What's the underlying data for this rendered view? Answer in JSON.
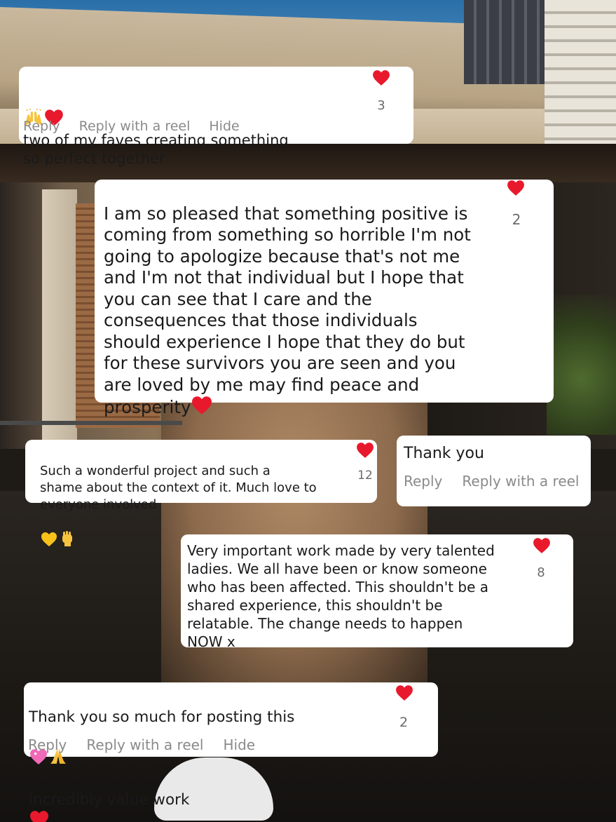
{
  "colors": {
    "heart": "#e8192c",
    "action_text": "#8a8a8a",
    "count_text": "#6b6b6b",
    "bubble": "#ffffff"
  },
  "comments": [
    {
      "text": "two of my faves creating something\nso perfect together",
      "leading_emojis": [
        "raising-hands-emoji",
        "red-heart-emoji"
      ],
      "like_count": "3",
      "actions": [
        "Reply",
        "Reply with a reel",
        "Hide"
      ]
    },
    {
      "text": "I am so pleased that something positive is\ncoming from something so horrible I'm not\ngoing to apologize because that's not me\nand I'm not that individual but I hope that\nyou can see that I care and the\nconsequences that those individuals\nshould experience I hope that they do but\nfor these survivors you are seen and you\nare loved by me may find peace and\nprosperity",
      "trailing_emojis": [
        "red-heart-emoji"
      ],
      "like_count": "2"
    },
    {
      "text": "Such a wonderful project and such a\nshame about the context of it. Much love to\neveryone involved",
      "trailing_emojis": [
        "yellow-heart-emoji",
        "raised-fist-emoji"
      ],
      "like_count": "12"
    },
    {
      "text": "Thank you",
      "actions": [
        "Reply",
        "Reply with a reel"
      ]
    },
    {
      "text": "Very important work made by very talented\nladies. We all have been or know someone\nwho has been affected. This shouldn't be a\nshared experience, this shouldn't be\nrelatable. The change needs to happen\nNOW x",
      "like_count": "8"
    },
    {
      "text": "Thank you so much for posting this",
      "trailing_emojis": [
        "sparkling-heart-emoji",
        "folded-hands-emoji"
      ],
      "text_line2": "incredibly value work",
      "line2_emojis": [
        "red-heart-emoji"
      ],
      "like_count": "2",
      "actions": [
        "Reply",
        "Reply with a reel",
        "Hide"
      ]
    }
  ]
}
